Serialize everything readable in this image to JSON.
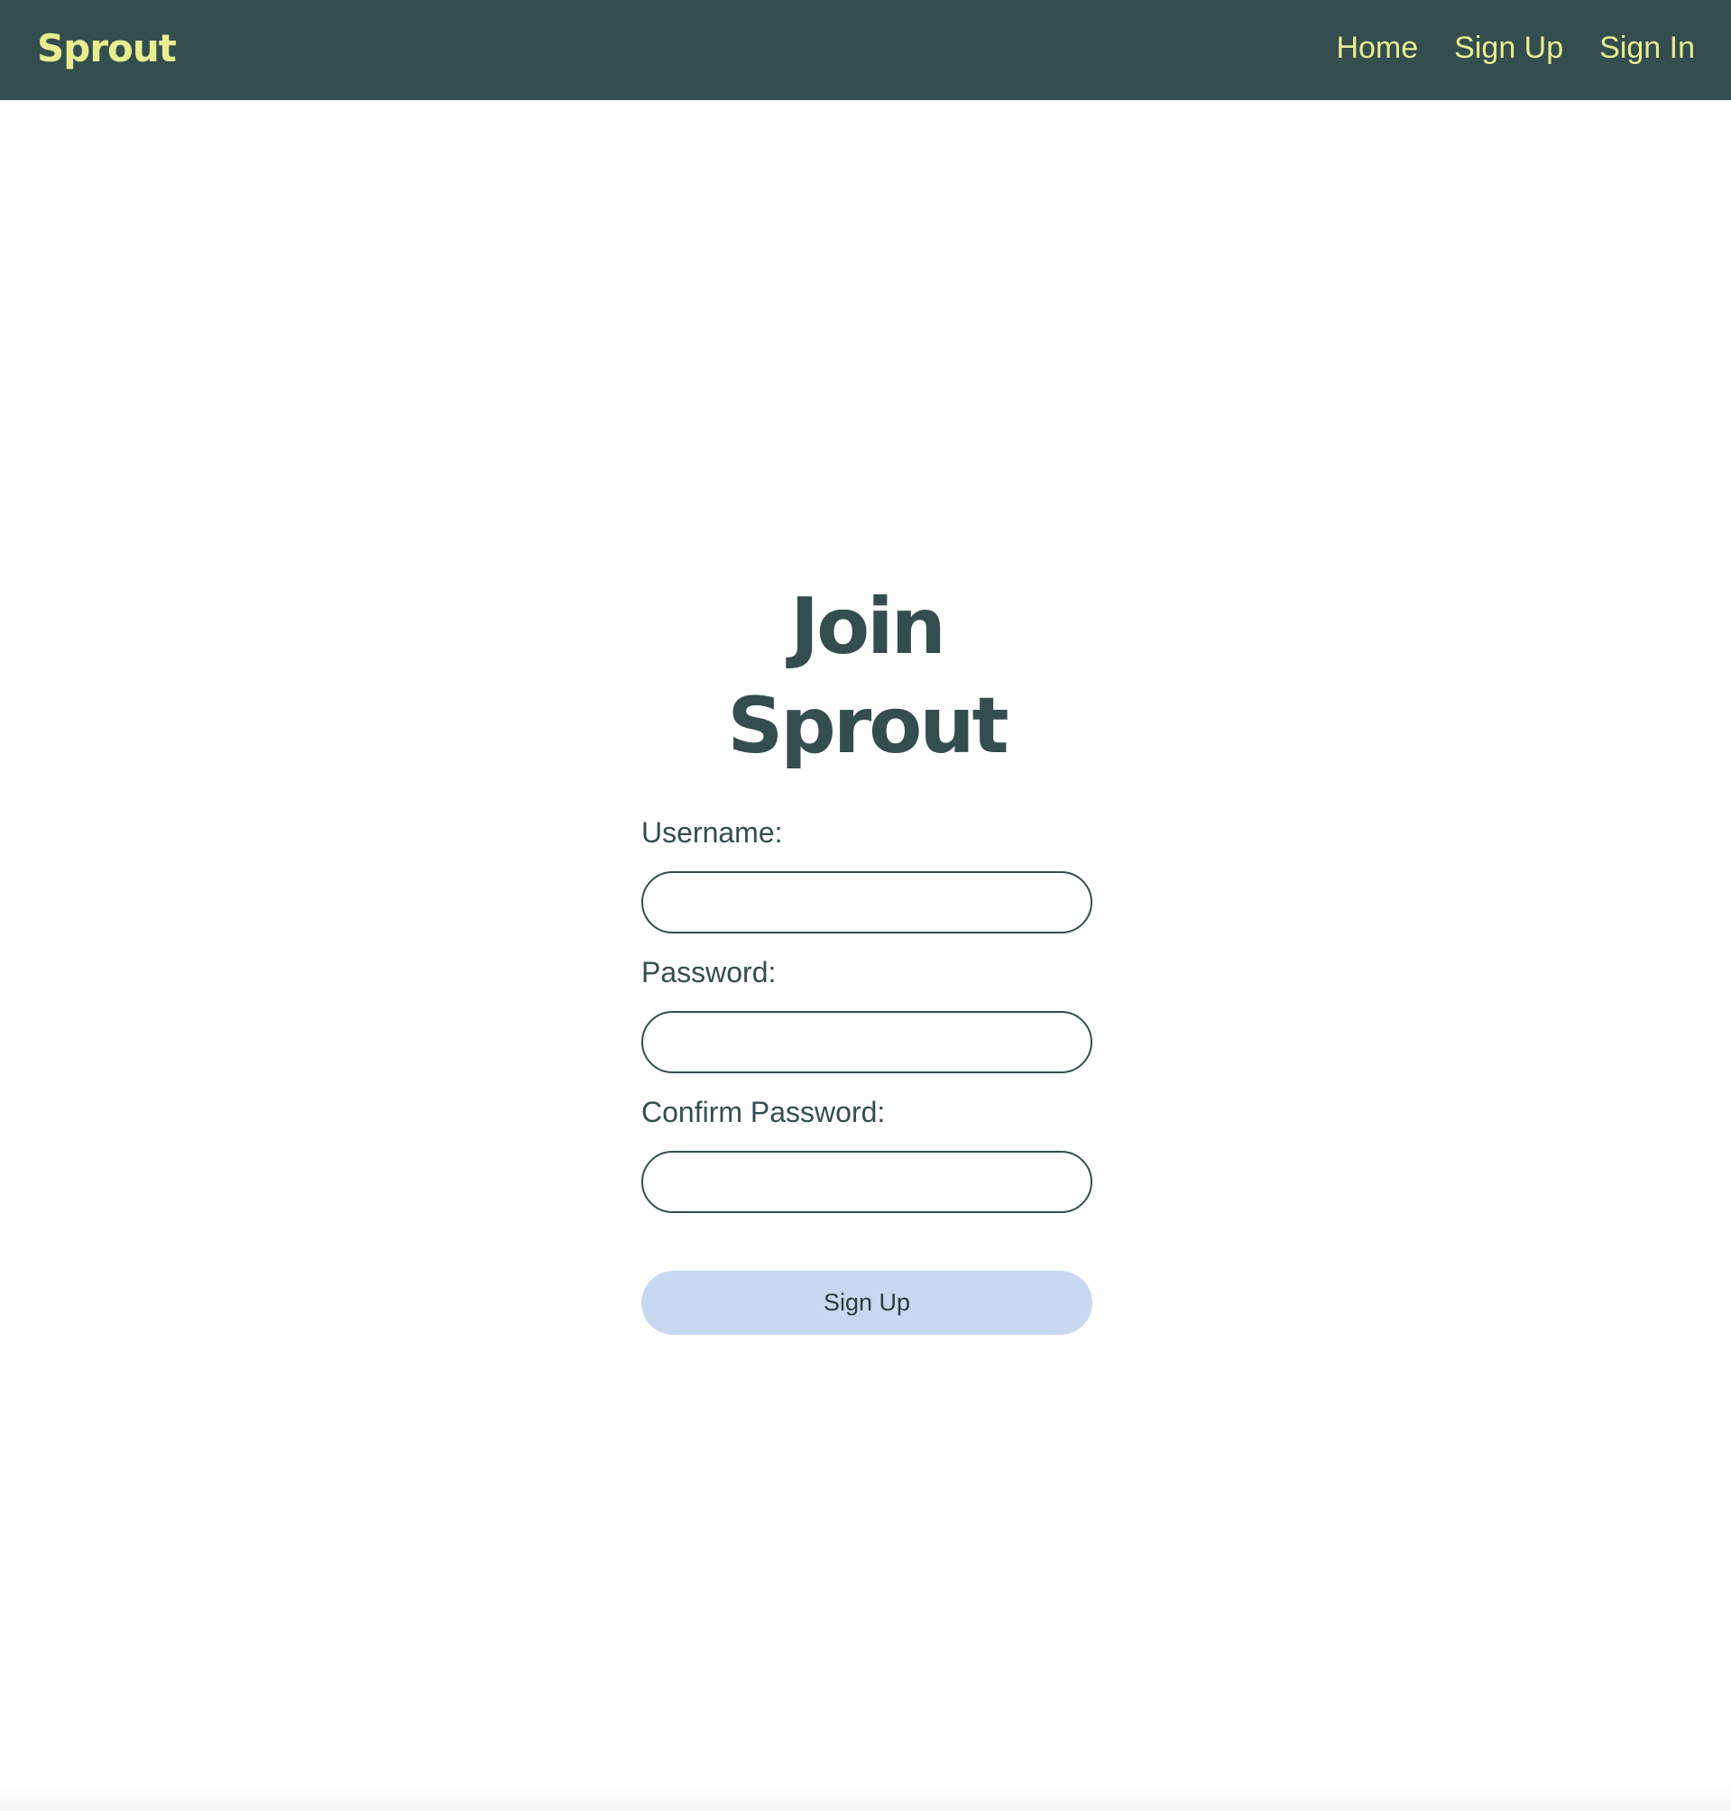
{
  "navbar": {
    "brand": "Sprout",
    "links": [
      {
        "label": "Home"
      },
      {
        "label": "Sign Up"
      },
      {
        "label": "Sign In"
      }
    ]
  },
  "main": {
    "title": "Join Sprout",
    "form": {
      "username_label": "Username:",
      "username_value": "",
      "password_label": "Password:",
      "password_value": "",
      "confirm_label": "Confirm Password:",
      "confirm_value": "",
      "submit_label": "Sign Up"
    }
  },
  "colors": {
    "navbar_bg": "#344d4e",
    "brand_accent": "#e8ed8f",
    "text": "#344d4e",
    "button_bg": "#c8d8f0"
  }
}
